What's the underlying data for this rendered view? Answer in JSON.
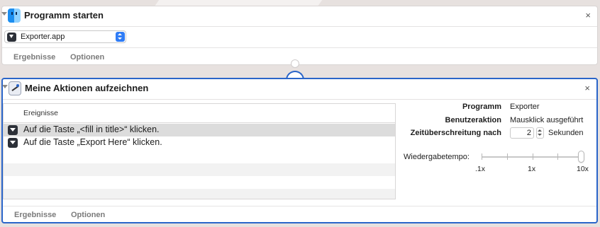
{
  "action1": {
    "title": "Programm starten",
    "app_popup": {
      "value": "Exporter.app",
      "icon": "app-icon"
    },
    "footer_tabs": [
      "Ergebnisse",
      "Optionen"
    ]
  },
  "action2": {
    "title": "Meine Aktionen aufzeichnen",
    "events": {
      "header": "Ereignisse",
      "rows": [
        "Auf die Taste „<fill in title>“ klicken.",
        "Auf die Taste „Export Here“ klicken."
      ]
    },
    "properties": {
      "program_label": "Programm",
      "program_value": "Exporter",
      "user_action_label": "Benutzeraktion",
      "user_action_value": "Mausklick ausgeführt",
      "timeout_label": "Zeitüberschreitung nach",
      "timeout_value": "2",
      "timeout_unit": "Sekunden"
    },
    "playback": {
      "label": "Wiedergabetempo:",
      "ticks": [
        ".1x",
        "1x",
        "10x"
      ],
      "value": "10x"
    },
    "footer_tabs": [
      "Ergebnisse",
      "Optionen"
    ]
  },
  "close_glyph": "×",
  "colors": {
    "accent": "#2a65c9",
    "selected_row": "#dcdcdc"
  }
}
